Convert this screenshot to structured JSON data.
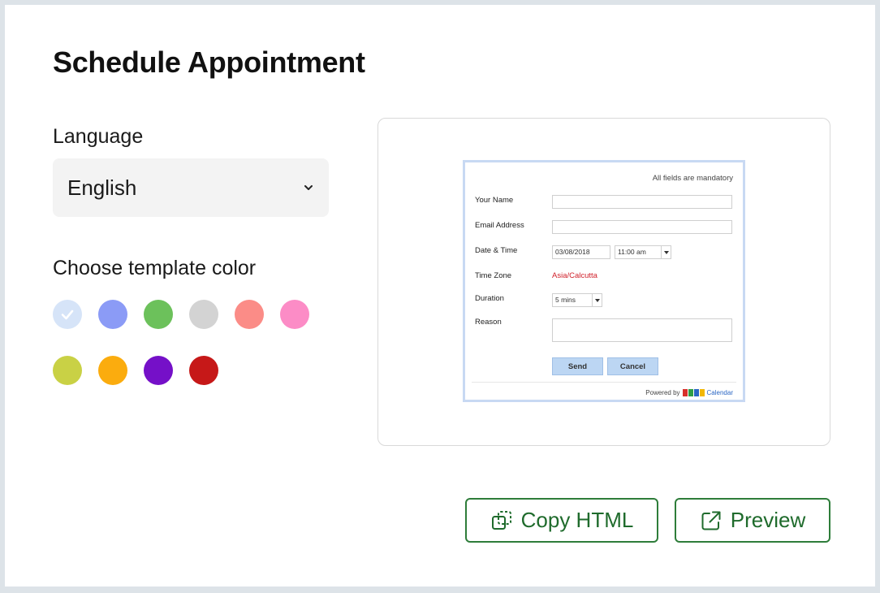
{
  "page": {
    "title": "Schedule Appointment"
  },
  "language": {
    "label": "Language",
    "selected": "English"
  },
  "template_color": {
    "label": "Choose template color",
    "swatches": [
      {
        "name": "light-blue",
        "color": "#d6e4f8",
        "selected": true
      },
      {
        "name": "periwinkle",
        "color": "#8b9bf6"
      },
      {
        "name": "green",
        "color": "#6cc15b"
      },
      {
        "name": "light-gray",
        "color": "#d3d3d3"
      },
      {
        "name": "salmon",
        "color": "#fb8c87"
      },
      {
        "name": "pink",
        "color": "#fc8cc6"
      },
      {
        "name": "olive",
        "color": "#c9d145"
      },
      {
        "name": "orange",
        "color": "#fbac0e"
      },
      {
        "name": "purple",
        "color": "#7510c8"
      },
      {
        "name": "red",
        "color": "#c61818"
      }
    ]
  },
  "preview_form": {
    "note": "All fields are mandatory",
    "name_label": "Your Name",
    "email_label": "Email Address",
    "datetime_label": "Date & Time",
    "date_value": "03/08/2018",
    "time_value": "11:00 am",
    "timezone_label": "Time Zone",
    "timezone_value": "Asia/Calcutta",
    "duration_label": "Duration",
    "duration_value": "5 mins",
    "reason_label": "Reason",
    "send_label": "Send",
    "cancel_label": "Cancel",
    "powered_by": "Powered by",
    "calendar_label": "Calendar"
  },
  "actions": {
    "copy_html": "Copy HTML",
    "preview": "Preview"
  },
  "colors": {
    "accent": "#2e7d3a",
    "select_bg": "#f3f3f3"
  }
}
